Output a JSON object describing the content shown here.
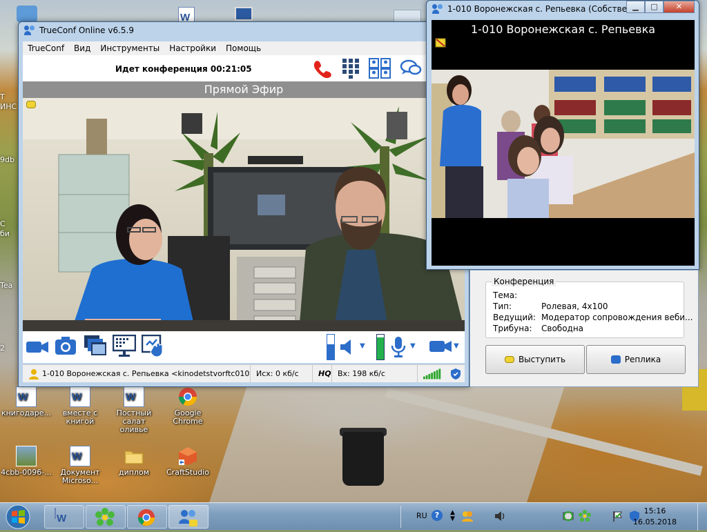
{
  "desktop": {
    "icons": [
      {
        "label": "книгодаре...",
        "type": "word"
      },
      {
        "label": "вместе с книгой",
        "type": "word"
      },
      {
        "label": "Постный салат оливье",
        "type": "word"
      },
      {
        "label": "Google Chrome",
        "type": "chrome"
      },
      {
        "label": "4cbb-0096-...",
        "type": "image"
      },
      {
        "label": "Документ Microso...",
        "type": "word"
      },
      {
        "label": "диплом",
        "type": "folder"
      },
      {
        "label": "CraftStudio",
        "type": "app"
      }
    ],
    "left_fragments": [
      "Т",
      "ИНС",
      "9db",
      "С",
      "би",
      "Tea",
      "2"
    ]
  },
  "main_window": {
    "title": "TrueConf Online v6.5.9",
    "menu": [
      "TrueConf",
      "Вид",
      "Инструменты",
      "Настройки",
      "Помощь"
    ],
    "conference_status": "Идет конференция 00:21:05",
    "live_label": "Прямой Эфир",
    "status": {
      "participant": "1-010  Воронежская с. Репьевка <kinodetstvorftc010@...",
      "out_rate": "Исх: 0 кб/с",
      "quality": "HQ",
      "in_rate": "Вх: 198 кб/с"
    },
    "volume_level": 0.6,
    "mic_level": 0.9
  },
  "remote_window": {
    "title": "1-010  Воронежская с. Репьевка (Собственн...",
    "caption": "1-010  Воронежская с. Репьевка"
  },
  "conference_panel": {
    "group_title": "Конференция",
    "rows": [
      {
        "key": "Тема:",
        "value": ""
      },
      {
        "key": "Тип:",
        "value": "Ролевая, 4x100"
      },
      {
        "key": "Ведущий:",
        "value": "Модератор сопровождения веби..."
      },
      {
        "key": "Трибуна:",
        "value": "Свободна"
      }
    ],
    "speak_button": "Выступить",
    "reply_button": "Реплика"
  },
  "taskbar": {
    "language": "RU",
    "time": "15:16",
    "date": "16.05.2018"
  },
  "colors": {
    "accent": "#2b6dc9",
    "hangup": "#e2231a",
    "signal": "#2aa52a",
    "level": "#22b14c"
  }
}
